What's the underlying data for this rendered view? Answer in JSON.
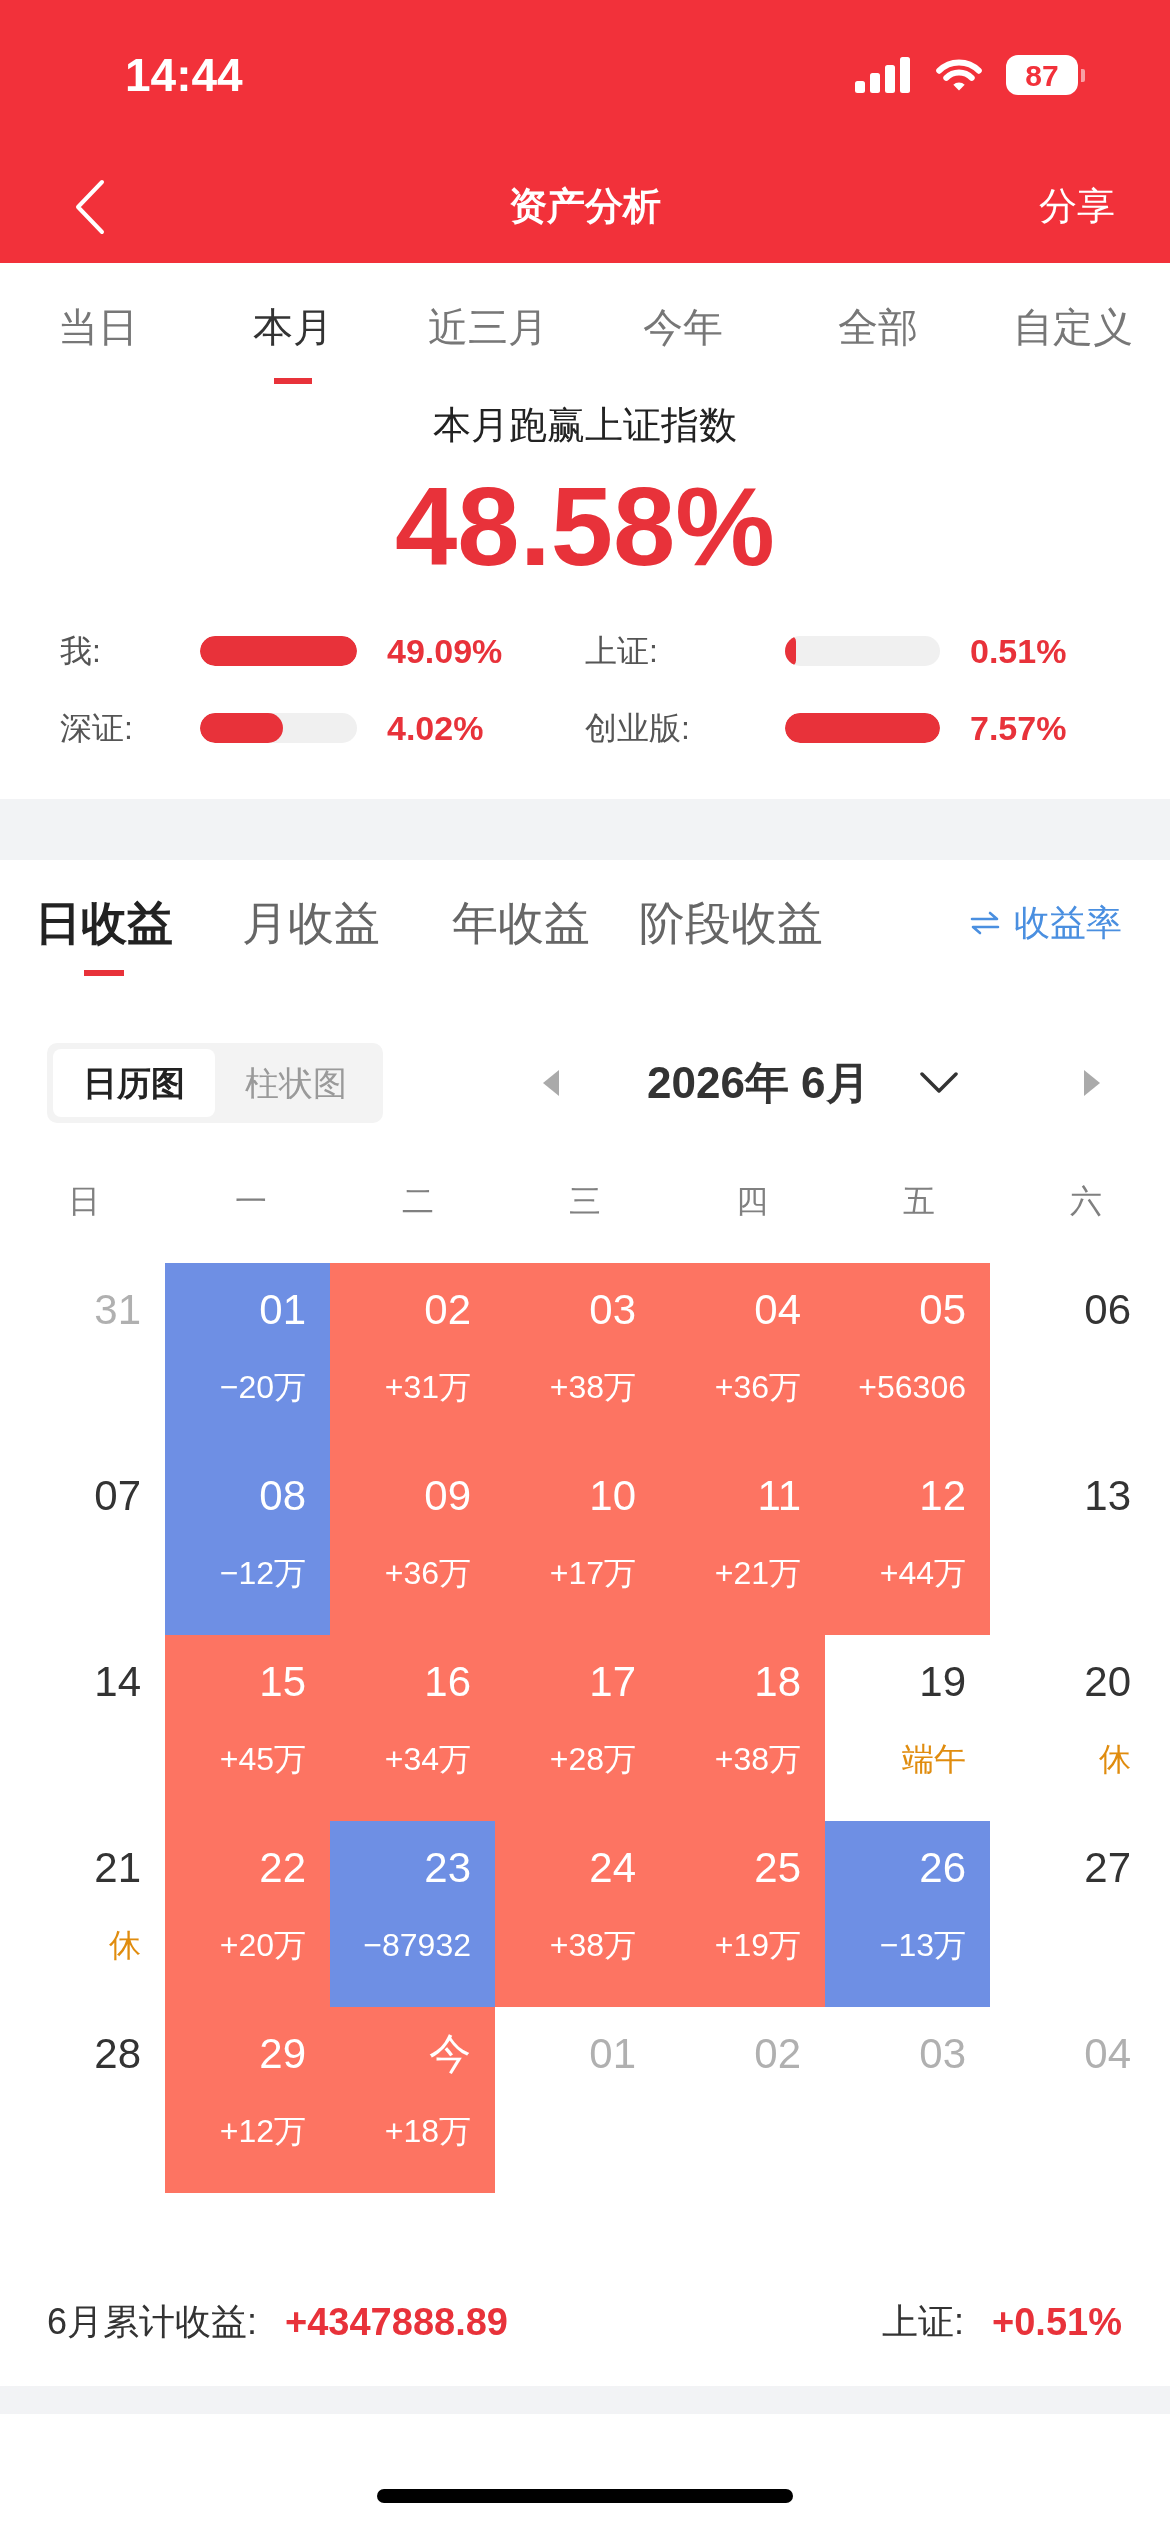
{
  "status_bar": {
    "time": "14:44",
    "battery": "87"
  },
  "nav": {
    "title": "资产分析",
    "action": "分享"
  },
  "period_tabs": [
    {
      "label": "当日",
      "selected": false
    },
    {
      "label": "本月",
      "selected": true
    },
    {
      "label": "近三月",
      "selected": false
    },
    {
      "label": "今年",
      "selected": false
    },
    {
      "label": "全部",
      "selected": false
    },
    {
      "label": "自定义",
      "selected": false
    }
  ],
  "summary": {
    "title": "本月跑赢上证指数",
    "value": "48.58%",
    "comparisons": [
      {
        "label": "我:",
        "level": 1,
        "reading": "49.09%"
      },
      {
        "label": "上证:",
        "level": 0.07,
        "reading": "0.51%"
      },
      {
        "label": "深证:",
        "level": 0.53,
        "reading": "4.02%"
      },
      {
        "label": "创业版:",
        "level": 1,
        "reading": "7.57%"
      }
    ]
  },
  "profit_tabs": [
    {
      "label": "日收益",
      "selected": true
    },
    {
      "label": "月收益",
      "selected": false
    },
    {
      "label": "年收益",
      "selected": false
    },
    {
      "label": "阶段收益",
      "selected": false
    }
  ],
  "rate_toggle": {
    "label": "收益率"
  },
  "view_switch": [
    {
      "label": "日历图",
      "selected": true
    },
    {
      "label": "柱状图",
      "selected": false
    }
  ],
  "month": {
    "label": "2026年 6月"
  },
  "weekdays": [
    "日",
    "一",
    "二",
    "三",
    "四",
    "五",
    "六"
  ],
  "weeks": [
    [
      {
        "day": "31",
        "muted": true
      },
      {
        "day": "01",
        "muted": false,
        "value": "−20万",
        "color": "#6e8fe4"
      },
      {
        "day": "02",
        "muted": false,
        "value": "+31万",
        "color": "#fd7462"
      },
      {
        "day": "03",
        "muted": false,
        "value": "+38万",
        "color": "#fd7462"
      },
      {
        "day": "04",
        "muted": false,
        "value": "+36万",
        "color": "#fd7462"
      },
      {
        "day": "05",
        "muted": false,
        "value": "+56306",
        "color": "#fd7462"
      },
      {
        "day": "06",
        "muted": false
      }
    ],
    [
      {
        "day": "07",
        "muted": false
      },
      {
        "day": "08",
        "muted": false,
        "value": "−12万",
        "color": "#6e8fe4"
      },
      {
        "day": "09",
        "muted": false,
        "value": "+36万",
        "color": "#fd7462"
      },
      {
        "day": "10",
        "muted": false,
        "value": "+17万",
        "color": "#fd7462"
      },
      {
        "day": "11",
        "muted": false,
        "value": "+21万",
        "color": "#fd7462"
      },
      {
        "day": "12",
        "muted": false,
        "value": "+44万",
        "color": "#fd7462"
      },
      {
        "day": "13",
        "muted": false
      }
    ],
    [
      {
        "day": "14",
        "muted": false
      },
      {
        "day": "15",
        "muted": false,
        "value": "+45万",
        "color": "#fd7462"
      },
      {
        "day": "16",
        "muted": false,
        "value": "+34万",
        "color": "#fd7462"
      },
      {
        "day": "17",
        "muted": false,
        "value": "+28万",
        "color": "#fd7462"
      },
      {
        "day": "18",
        "muted": false,
        "value": "+38万",
        "color": "#fd7462"
      },
      {
        "day": "19",
        "muted": false,
        "note": "端午"
      },
      {
        "day": "20",
        "muted": false,
        "note": "休"
      }
    ],
    [
      {
        "day": "21",
        "muted": false,
        "note": "休"
      },
      {
        "day": "22",
        "muted": false,
        "value": "+20万",
        "color": "#fd7462"
      },
      {
        "day": "23",
        "muted": false,
        "value": "−87932",
        "color": "#6e8fe4"
      },
      {
        "day": "24",
        "muted": false,
        "value": "+38万",
        "color": "#fd7462"
      },
      {
        "day": "25",
        "muted": false,
        "value": "+19万",
        "color": "#fd7462"
      },
      {
        "day": "26",
        "muted": false,
        "value": "−13万",
        "color": "#6e8fe4"
      },
      {
        "day": "27",
        "muted": false
      }
    ],
    [
      {
        "day": "28",
        "muted": false
      },
      {
        "day": "29",
        "muted": false,
        "value": "+12万",
        "color": "#fd7462"
      },
      {
        "day": "今",
        "muted": false,
        "value": "+18万",
        "color": "#fd7462"
      },
      {
        "day": "01",
        "muted": true
      },
      {
        "day": "02",
        "muted": true
      },
      {
        "day": "03",
        "muted": true
      },
      {
        "day": "04",
        "muted": true
      }
    ]
  ],
  "footer": {
    "label": "6月累计收益:",
    "value": "+4347888.89",
    "index_label": "上证:",
    "index_value": "+0.51%"
  }
}
